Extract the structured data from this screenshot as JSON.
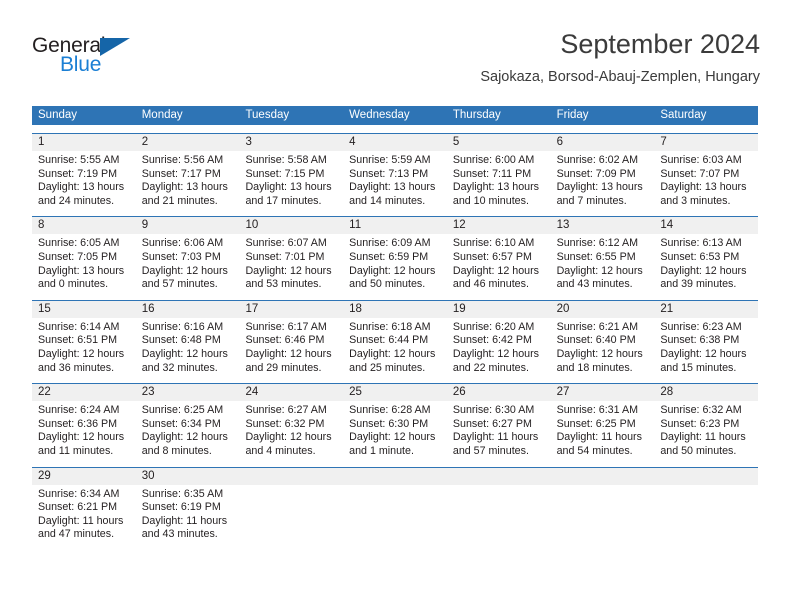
{
  "brand": {
    "name_dark": "General",
    "name_blue": "Blue",
    "accent_color": "#1b7fd4",
    "triangle_color": "#1565a8",
    "logo_icon": "triangle-flag-icon"
  },
  "header": {
    "title": "September 2024",
    "subtitle": "Sajokaza, Borsod-Abauj-Zemplen, Hungary"
  },
  "calendar": {
    "header_bg": "#2e74b5",
    "daynum_bg": "#f0f0f0",
    "weekday_headers": [
      "Sunday",
      "Monday",
      "Tuesday",
      "Wednesday",
      "Thursday",
      "Friday",
      "Saturday"
    ],
    "weeks": [
      [
        {
          "day": "1",
          "sunrise": "Sunrise: 5:55 AM",
          "sunset": "Sunset: 7:19 PM",
          "daylight_line1": "Daylight: 13 hours",
          "daylight_line2": "and 24 minutes."
        },
        {
          "day": "2",
          "sunrise": "Sunrise: 5:56 AM",
          "sunset": "Sunset: 7:17 PM",
          "daylight_line1": "Daylight: 13 hours",
          "daylight_line2": "and 21 minutes."
        },
        {
          "day": "3",
          "sunrise": "Sunrise: 5:58 AM",
          "sunset": "Sunset: 7:15 PM",
          "daylight_line1": "Daylight: 13 hours",
          "daylight_line2": "and 17 minutes."
        },
        {
          "day": "4",
          "sunrise": "Sunrise: 5:59 AM",
          "sunset": "Sunset: 7:13 PM",
          "daylight_line1": "Daylight: 13 hours",
          "daylight_line2": "and 14 minutes."
        },
        {
          "day": "5",
          "sunrise": "Sunrise: 6:00 AM",
          "sunset": "Sunset: 7:11 PM",
          "daylight_line1": "Daylight: 13 hours",
          "daylight_line2": "and 10 minutes."
        },
        {
          "day": "6",
          "sunrise": "Sunrise: 6:02 AM",
          "sunset": "Sunset: 7:09 PM",
          "daylight_line1": "Daylight: 13 hours",
          "daylight_line2": "and 7 minutes."
        },
        {
          "day": "7",
          "sunrise": "Sunrise: 6:03 AM",
          "sunset": "Sunset: 7:07 PM",
          "daylight_line1": "Daylight: 13 hours",
          "daylight_line2": "and 3 minutes."
        }
      ],
      [
        {
          "day": "8",
          "sunrise": "Sunrise: 6:05 AM",
          "sunset": "Sunset: 7:05 PM",
          "daylight_line1": "Daylight: 13 hours",
          "daylight_line2": "and 0 minutes."
        },
        {
          "day": "9",
          "sunrise": "Sunrise: 6:06 AM",
          "sunset": "Sunset: 7:03 PM",
          "daylight_line1": "Daylight: 12 hours",
          "daylight_line2": "and 57 minutes."
        },
        {
          "day": "10",
          "sunrise": "Sunrise: 6:07 AM",
          "sunset": "Sunset: 7:01 PM",
          "daylight_line1": "Daylight: 12 hours",
          "daylight_line2": "and 53 minutes."
        },
        {
          "day": "11",
          "sunrise": "Sunrise: 6:09 AM",
          "sunset": "Sunset: 6:59 PM",
          "daylight_line1": "Daylight: 12 hours",
          "daylight_line2": "and 50 minutes."
        },
        {
          "day": "12",
          "sunrise": "Sunrise: 6:10 AM",
          "sunset": "Sunset: 6:57 PM",
          "daylight_line1": "Daylight: 12 hours",
          "daylight_line2": "and 46 minutes."
        },
        {
          "day": "13",
          "sunrise": "Sunrise: 6:12 AM",
          "sunset": "Sunset: 6:55 PM",
          "daylight_line1": "Daylight: 12 hours",
          "daylight_line2": "and 43 minutes."
        },
        {
          "day": "14",
          "sunrise": "Sunrise: 6:13 AM",
          "sunset": "Sunset: 6:53 PM",
          "daylight_line1": "Daylight: 12 hours",
          "daylight_line2": "and 39 minutes."
        }
      ],
      [
        {
          "day": "15",
          "sunrise": "Sunrise: 6:14 AM",
          "sunset": "Sunset: 6:51 PM",
          "daylight_line1": "Daylight: 12 hours",
          "daylight_line2": "and 36 minutes."
        },
        {
          "day": "16",
          "sunrise": "Sunrise: 6:16 AM",
          "sunset": "Sunset: 6:48 PM",
          "daylight_line1": "Daylight: 12 hours",
          "daylight_line2": "and 32 minutes."
        },
        {
          "day": "17",
          "sunrise": "Sunrise: 6:17 AM",
          "sunset": "Sunset: 6:46 PM",
          "daylight_line1": "Daylight: 12 hours",
          "daylight_line2": "and 29 minutes."
        },
        {
          "day": "18",
          "sunrise": "Sunrise: 6:18 AM",
          "sunset": "Sunset: 6:44 PM",
          "daylight_line1": "Daylight: 12 hours",
          "daylight_line2": "and 25 minutes."
        },
        {
          "day": "19",
          "sunrise": "Sunrise: 6:20 AM",
          "sunset": "Sunset: 6:42 PM",
          "daylight_line1": "Daylight: 12 hours",
          "daylight_line2": "and 22 minutes."
        },
        {
          "day": "20",
          "sunrise": "Sunrise: 6:21 AM",
          "sunset": "Sunset: 6:40 PM",
          "daylight_line1": "Daylight: 12 hours",
          "daylight_line2": "and 18 minutes."
        },
        {
          "day": "21",
          "sunrise": "Sunrise: 6:23 AM",
          "sunset": "Sunset: 6:38 PM",
          "daylight_line1": "Daylight: 12 hours",
          "daylight_line2": "and 15 minutes."
        }
      ],
      [
        {
          "day": "22",
          "sunrise": "Sunrise: 6:24 AM",
          "sunset": "Sunset: 6:36 PM",
          "daylight_line1": "Daylight: 12 hours",
          "daylight_line2": "and 11 minutes."
        },
        {
          "day": "23",
          "sunrise": "Sunrise: 6:25 AM",
          "sunset": "Sunset: 6:34 PM",
          "daylight_line1": "Daylight: 12 hours",
          "daylight_line2": "and 8 minutes."
        },
        {
          "day": "24",
          "sunrise": "Sunrise: 6:27 AM",
          "sunset": "Sunset: 6:32 PM",
          "daylight_line1": "Daylight: 12 hours",
          "daylight_line2": "and 4 minutes."
        },
        {
          "day": "25",
          "sunrise": "Sunrise: 6:28 AM",
          "sunset": "Sunset: 6:30 PM",
          "daylight_line1": "Daylight: 12 hours",
          "daylight_line2": "and 1 minute."
        },
        {
          "day": "26",
          "sunrise": "Sunrise: 6:30 AM",
          "sunset": "Sunset: 6:27 PM",
          "daylight_line1": "Daylight: 11 hours",
          "daylight_line2": "and 57 minutes."
        },
        {
          "day": "27",
          "sunrise": "Sunrise: 6:31 AM",
          "sunset": "Sunset: 6:25 PM",
          "daylight_line1": "Daylight: 11 hours",
          "daylight_line2": "and 54 minutes."
        },
        {
          "day": "28",
          "sunrise": "Sunrise: 6:32 AM",
          "sunset": "Sunset: 6:23 PM",
          "daylight_line1": "Daylight: 11 hours",
          "daylight_line2": "and 50 minutes."
        }
      ],
      [
        {
          "day": "29",
          "sunrise": "Sunrise: 6:34 AM",
          "sunset": "Sunset: 6:21 PM",
          "daylight_line1": "Daylight: 11 hours",
          "daylight_line2": "and 47 minutes."
        },
        {
          "day": "30",
          "sunrise": "Sunrise: 6:35 AM",
          "sunset": "Sunset: 6:19 PM",
          "daylight_line1": "Daylight: 11 hours",
          "daylight_line2": "and 43 minutes."
        },
        {
          "day": "",
          "sunrise": "",
          "sunset": "",
          "daylight_line1": "",
          "daylight_line2": ""
        },
        {
          "day": "",
          "sunrise": "",
          "sunset": "",
          "daylight_line1": "",
          "daylight_line2": ""
        },
        {
          "day": "",
          "sunrise": "",
          "sunset": "",
          "daylight_line1": "",
          "daylight_line2": ""
        },
        {
          "day": "",
          "sunrise": "",
          "sunset": "",
          "daylight_line1": "",
          "daylight_line2": ""
        },
        {
          "day": "",
          "sunrise": "",
          "sunset": "",
          "daylight_line1": "",
          "daylight_line2": ""
        }
      ]
    ]
  }
}
